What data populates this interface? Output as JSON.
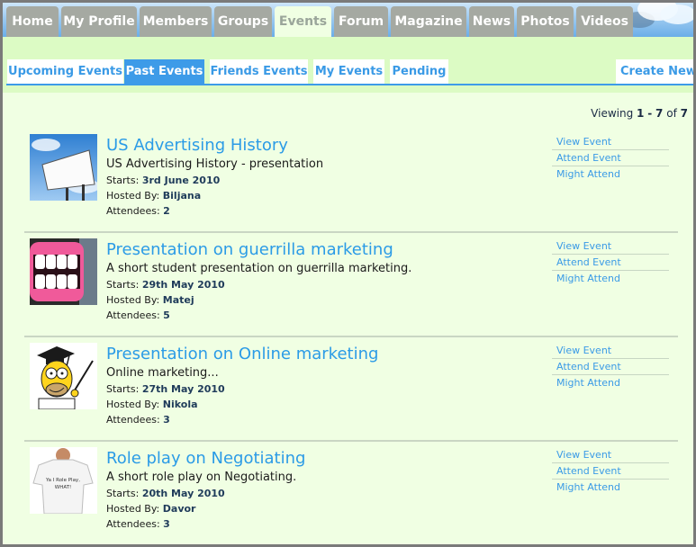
{
  "nav": {
    "tabs": [
      {
        "label": "Home"
      },
      {
        "label": "My Profile"
      },
      {
        "label": "Members"
      },
      {
        "label": "Groups"
      },
      {
        "label": "Events"
      },
      {
        "label": "Forum"
      },
      {
        "label": "Magazine"
      },
      {
        "label": "News"
      },
      {
        "label": "Photos"
      },
      {
        "label": "Videos"
      }
    ],
    "active": "Events"
  },
  "subnav": {
    "tabs": [
      {
        "label": "Upcoming Events"
      },
      {
        "label": "Past Events"
      },
      {
        "label": "Friends Events"
      },
      {
        "label": "My Events"
      },
      {
        "label": "Pending"
      }
    ],
    "active": "Past Events",
    "create_label": "Create New"
  },
  "viewing": {
    "prefix": "Viewing",
    "from": "1",
    "sep": "-",
    "to": "7",
    "of": "of",
    "total": "7"
  },
  "labels": {
    "starts": "Starts:",
    "hosted": "Hosted By:",
    "attendees": "Attendees:"
  },
  "actions": {
    "view": "View Event",
    "attend": "Attend Event",
    "might": "Might Attend"
  },
  "events": [
    {
      "title": "US Advertising History",
      "desc": "US Advertising History - presentation",
      "starts": "3rd June 2010",
      "host": "Biljana",
      "attendees": "2",
      "thumb": "billboard"
    },
    {
      "title": "Presentation on guerrilla marketing",
      "desc": "A short student presentation on guerrilla marketing.",
      "starts": "29th May 2010",
      "host": "Matej",
      "attendees": "5",
      "thumb": "teeth"
    },
    {
      "title": "Presentation on Online marketing",
      "desc": "Online marketing...",
      "starts": "27th May 2010",
      "host": "Nikola",
      "attendees": "3",
      "thumb": "cartoon-professor"
    },
    {
      "title": "Role play on Negotiating",
      "desc": "A short role play on Negotiating.",
      "starts": "20th May 2010",
      "host": "Davor",
      "attendees": "3",
      "thumb": "tshirt"
    }
  ],
  "tshirt_text": {
    "line1": "Ya I Role Play,",
    "line2": "WHAT!"
  }
}
